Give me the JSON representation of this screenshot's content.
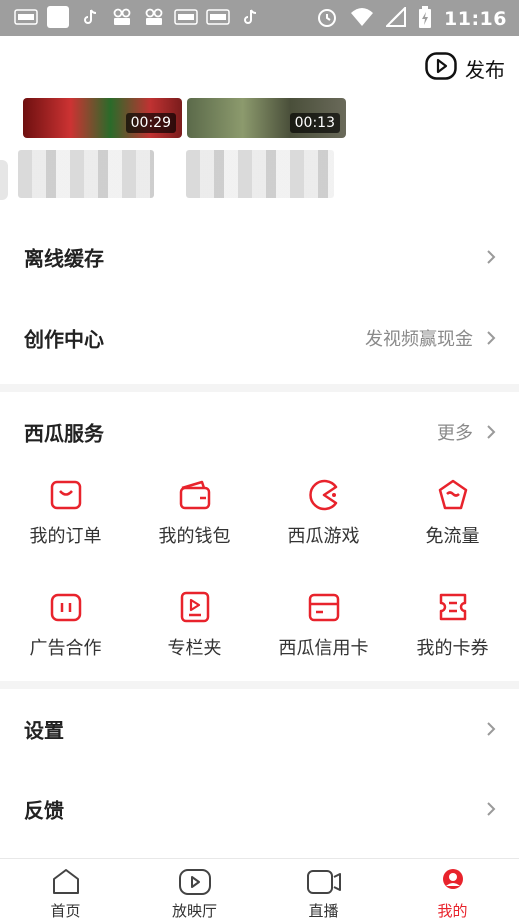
{
  "status_bar": {
    "time": "11:16",
    "left_icons": [
      "toutiao-icon",
      "app-icon",
      "tiktok-icon",
      "video-icon",
      "video-icon",
      "toutiao-icon",
      "toutiao-icon",
      "tiktok-icon"
    ],
    "right_icons": [
      "alarm-icon",
      "wifi-icon",
      "signal-icon",
      "battery-icon"
    ]
  },
  "header": {
    "publish_label": "发布"
  },
  "history": {
    "videos": [
      {
        "duration": "00:29"
      },
      {
        "duration": "00:13"
      }
    ]
  },
  "rows_top": [
    {
      "title": "离线缓存",
      "subtitle": ""
    },
    {
      "title": "创作中心",
      "subtitle": "发视频赢现金"
    }
  ],
  "services": {
    "title": "西瓜服务",
    "more": "更多",
    "items": [
      {
        "label": "我的订单",
        "icon": "order-icon"
      },
      {
        "label": "我的钱包",
        "icon": "wallet-icon"
      },
      {
        "label": "西瓜游戏",
        "icon": "game-icon"
      },
      {
        "label": "免流量",
        "icon": "free-data-icon"
      },
      {
        "label": "广告合作",
        "icon": "ad-icon"
      },
      {
        "label": "专栏夹",
        "icon": "column-icon"
      },
      {
        "label": "西瓜信用卡",
        "icon": "credit-card-icon"
      },
      {
        "label": "我的卡券",
        "icon": "coupon-icon"
      }
    ]
  },
  "rows_bottom": [
    {
      "title": "设置"
    },
    {
      "title": "反馈"
    }
  ],
  "bottom_nav": [
    {
      "label": "首页",
      "icon": "home-icon"
    },
    {
      "label": "放映厅",
      "icon": "theater-icon"
    },
    {
      "label": "直播",
      "icon": "live-icon"
    },
    {
      "label": "我的",
      "icon": "profile-icon",
      "active": true
    }
  ],
  "colors": {
    "accent": "#e8232c",
    "status_bar": "#9e9e9e"
  }
}
